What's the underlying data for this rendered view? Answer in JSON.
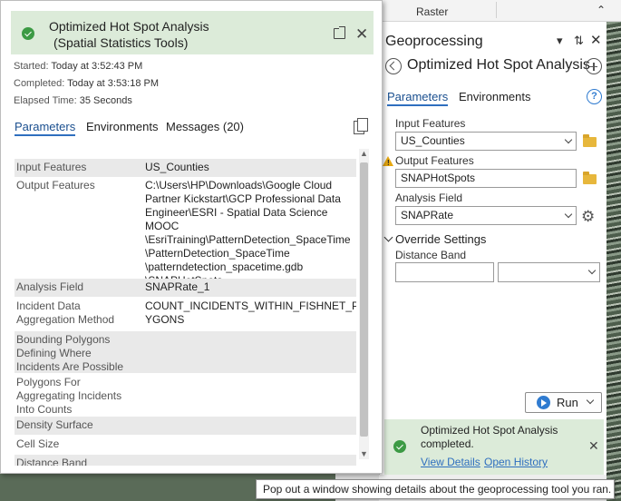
{
  "popup": {
    "title": "Optimized Hot Spot Analysis",
    "subtitle": "(Spatial Statistics Tools)",
    "started_label": "Started:",
    "started_value": "Today at 3:52:43 PM",
    "completed_label": "Completed:",
    "completed_value": "Today at 3:53:18 PM",
    "elapsed_label": "Elapsed Time:",
    "elapsed_value": "35 Seconds",
    "tabs": [
      {
        "label": "Parameters"
      },
      {
        "label": "Environments"
      },
      {
        "label": "Messages (20)"
      }
    ],
    "parameters": [
      {
        "key": "Input Features",
        "value": "US_Counties"
      },
      {
        "key": "Output Features",
        "value": "C:\\Users\\HP\\Downloads\\Google Cloud Partner Kickstart\\GCP Professional Data Engineer\\ESRI - Spatial Data Science MOOC\\EsriTraining\\PatternDetection_SpaceTime\\PatternDetection_SpaceTime\\patterndetection_spacetime.gdb\\SNAPHotSpots"
      },
      {
        "key": "Analysis Field",
        "value": "SNAPRate_1"
      },
      {
        "key": "Incident Data Aggregation Method",
        "value": "COUNT_INCIDENTS_WITHIN_FISHNET_POLYGONS"
      },
      {
        "key": "Bounding Polygons Defining Where Incidents Are Possible",
        "value": ""
      },
      {
        "key": "Polygons For Aggregating Incidents Into Counts",
        "value": ""
      },
      {
        "key": "Density Surface",
        "value": ""
      },
      {
        "key": "Cell Size",
        "value": ""
      },
      {
        "key": "Distance Band",
        "value": ""
      }
    ],
    "output_lines": [
      "C:\\Users\\HP\\Downloads\\Google Cloud",
      "Partner Kickstart\\GCP Professional Data",
      "Engineer\\ESRI - Spatial Data Science MOOC",
      "\\EsriTraining\\PatternDetection_SpaceTime",
      "\\PatternDetection_SpaceTime",
      "\\patterndetection_spacetime.gdb",
      "\\SNAPHotSpots"
    ],
    "agg_lines": [
      "COUNT_INCIDENTS_WITHIN_FISHNET_POL",
      "YGONS"
    ],
    "agg_key_lines": [
      "Incident Data",
      "Aggregation Method"
    ],
    "bounding_key_lines": [
      "Bounding Polygons",
      "Defining Where",
      "Incidents Are Possible"
    ],
    "polygons_key_lines": [
      "Polygons For",
      "Aggregating Incidents",
      "Into Counts"
    ]
  },
  "ribbon": {
    "raster_label": "Raster"
  },
  "geoprocessing": {
    "pane_title": "Geoprocessing",
    "tool_title": "Optimized Hot Spot Analysis",
    "tabs": [
      {
        "label": "Parameters"
      },
      {
        "label": "Environments"
      }
    ],
    "help_glyph": "?",
    "input_features_label": "Input Features",
    "input_features_value": "US_Counties",
    "output_features_label": "Output Features",
    "output_features_value": "SNAPHotSpots",
    "analysis_field_label": "Analysis Field",
    "analysis_field_value": "SNAPRate",
    "override_title": "Override Settings",
    "distance_band_label": "Distance Band",
    "run_label": "Run",
    "completed_message": "Optimized Hot Spot Analysis completed.",
    "view_details": "View Details",
    "open_history": "Open History"
  },
  "tooltip": {
    "text": "Pop out a window showing details about the geoprocessing tool you ran."
  },
  "colors": {
    "success_green": "#3c9a44",
    "success_bg": "#dcebd9",
    "accent_blue": "#2f6fbf",
    "folder_yellow": "#e7b73c",
    "warning_yellow": "#e8a80f"
  }
}
